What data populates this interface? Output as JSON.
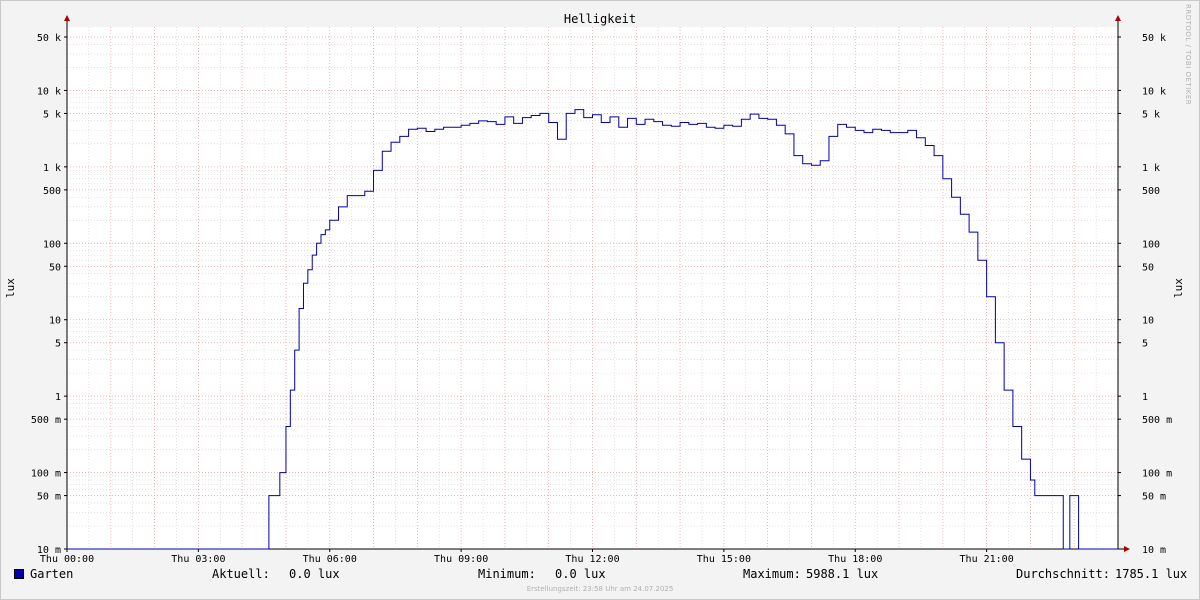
{
  "chart_data": {
    "type": "line",
    "title": "Helligkeit",
    "ylabel": "lux",
    "yscale": "log",
    "ylim": [
      0.01,
      50000
    ],
    "xlim_hours": [
      0,
      24
    ],
    "y_ticks": [
      {
        "v": 50000,
        "label": "50 k"
      },
      {
        "v": 10000,
        "label": "10 k"
      },
      {
        "v": 5000,
        "label": "5 k"
      },
      {
        "v": 1000,
        "label": "1 k"
      },
      {
        "v": 500,
        "label": "500"
      },
      {
        "v": 100,
        "label": "100"
      },
      {
        "v": 50,
        "label": "50"
      },
      {
        "v": 10,
        "label": "10"
      },
      {
        "v": 5,
        "label": "5"
      },
      {
        "v": 1,
        "label": "1"
      },
      {
        "v": 0.5,
        "label": "500 m"
      },
      {
        "v": 0.1,
        "label": "100 m"
      },
      {
        "v": 0.05,
        "label": "50 m"
      },
      {
        "v": 0.01,
        "label": "10 m"
      }
    ],
    "x_ticks": [
      {
        "h": 0,
        "label": "Thu 00:00"
      },
      {
        "h": 3,
        "label": "Thu 03:00"
      },
      {
        "h": 6,
        "label": "Thu 06:00"
      },
      {
        "h": 9,
        "label": "Thu 09:00"
      },
      {
        "h": 12,
        "label": "Thu 12:00"
      },
      {
        "h": 15,
        "label": "Thu 15:00"
      },
      {
        "h": 18,
        "label": "Thu 18:00"
      },
      {
        "h": 21,
        "label": "Thu 21:00"
      }
    ],
    "grid": true,
    "series": [
      {
        "name": "Garten",
        "color": "#0000aa",
        "x": [
          0,
          4.6,
          4.61,
          4.85,
          4.86,
          5.0,
          5.1,
          5.2,
          5.3,
          5.4,
          5.5,
          5.6,
          5.7,
          5.8,
          5.9,
          6.0,
          6.2,
          6.4,
          6.6,
          6.8,
          7.0,
          7.2,
          7.4,
          7.6,
          7.8,
          8.0,
          8.2,
          8.4,
          8.6,
          8.8,
          9.0,
          9.2,
          9.4,
          9.6,
          9.8,
          10.0,
          10.2,
          10.4,
          10.6,
          10.8,
          11.0,
          11.2,
          11.4,
          11.6,
          11.8,
          12.0,
          12.2,
          12.4,
          12.6,
          12.8,
          13.0,
          13.2,
          13.4,
          13.6,
          13.8,
          14.0,
          14.2,
          14.4,
          14.6,
          14.8,
          15.0,
          15.2,
          15.4,
          15.6,
          15.8,
          16.0,
          16.2,
          16.4,
          16.6,
          16.8,
          17.0,
          17.2,
          17.4,
          17.6,
          17.8,
          18.0,
          18.2,
          18.4,
          18.6,
          18.8,
          19.0,
          19.2,
          19.4,
          19.6,
          19.8,
          20.0,
          20.2,
          20.4,
          20.6,
          20.8,
          21.0,
          21.2,
          21.4,
          21.6,
          21.8,
          22.0,
          22.1,
          22.2,
          22.3,
          22.4,
          22.5,
          22.6,
          22.7,
          22.75,
          22.8,
          22.9,
          23.0,
          23.09,
          23.1,
          23.14,
          23.15,
          23.29,
          23.3,
          24.0
        ],
        "y": [
          0.01,
          0.01,
          0.05,
          0.05,
          0.1,
          0.4,
          1.2,
          4,
          14,
          30,
          45,
          70,
          100,
          130,
          150,
          200,
          300,
          420,
          420,
          480,
          900,
          1600,
          2100,
          2500,
          3100,
          3200,
          2900,
          3100,
          3300,
          3300,
          3500,
          3700,
          4000,
          3900,
          3600,
          4500,
          3700,
          4400,
          4700,
          5000,
          3800,
          2300,
          5000,
          5600,
          4400,
          4800,
          3800,
          4500,
          3300,
          4300,
          3600,
          4200,
          3900,
          3500,
          3400,
          3800,
          3600,
          3700,
          3300,
          3200,
          3500,
          3400,
          4200,
          4900,
          4300,
          4200,
          3500,
          2700,
          1400,
          1100,
          1050,
          1200,
          2500,
          3600,
          3300,
          3000,
          2800,
          3100,
          3000,
          2800,
          2800,
          3000,
          2400,
          1900,
          1400,
          700,
          400,
          240,
          140,
          60,
          20,
          5,
          1.2,
          0.4,
          0.15,
          0.08,
          0.05,
          0.05,
          0.05,
          0.05,
          0.05,
          0.05,
          0.05,
          0.01,
          0.01,
          0.05,
          0.05,
          0.05,
          0.01,
          0.01,
          0.01,
          0.01,
          0.01,
          0.01
        ]
      }
    ],
    "stats": {
      "aktuell_label": "Aktuell:",
      "aktuell": "0.0 lux",
      "minimum_label": "Minimum:",
      "minimum": "0.0 lux",
      "maximum_label": "Maximum:",
      "maximum": "5988.1 lux",
      "durchschnitt_label": "Durchschnitt:",
      "durchschnitt": "1785.1 lux"
    }
  },
  "footer": "Erstellungszeit: 23:58 Uhr am 24.07.2025",
  "watermark": "RRDTOOL / TOBI OETIKER",
  "colors": {
    "series": "#0000aa",
    "grid_major": "#f0a0a0",
    "grid_minor": "#d0d0d0",
    "axis": "#000000",
    "arrow": "#aa0000"
  }
}
